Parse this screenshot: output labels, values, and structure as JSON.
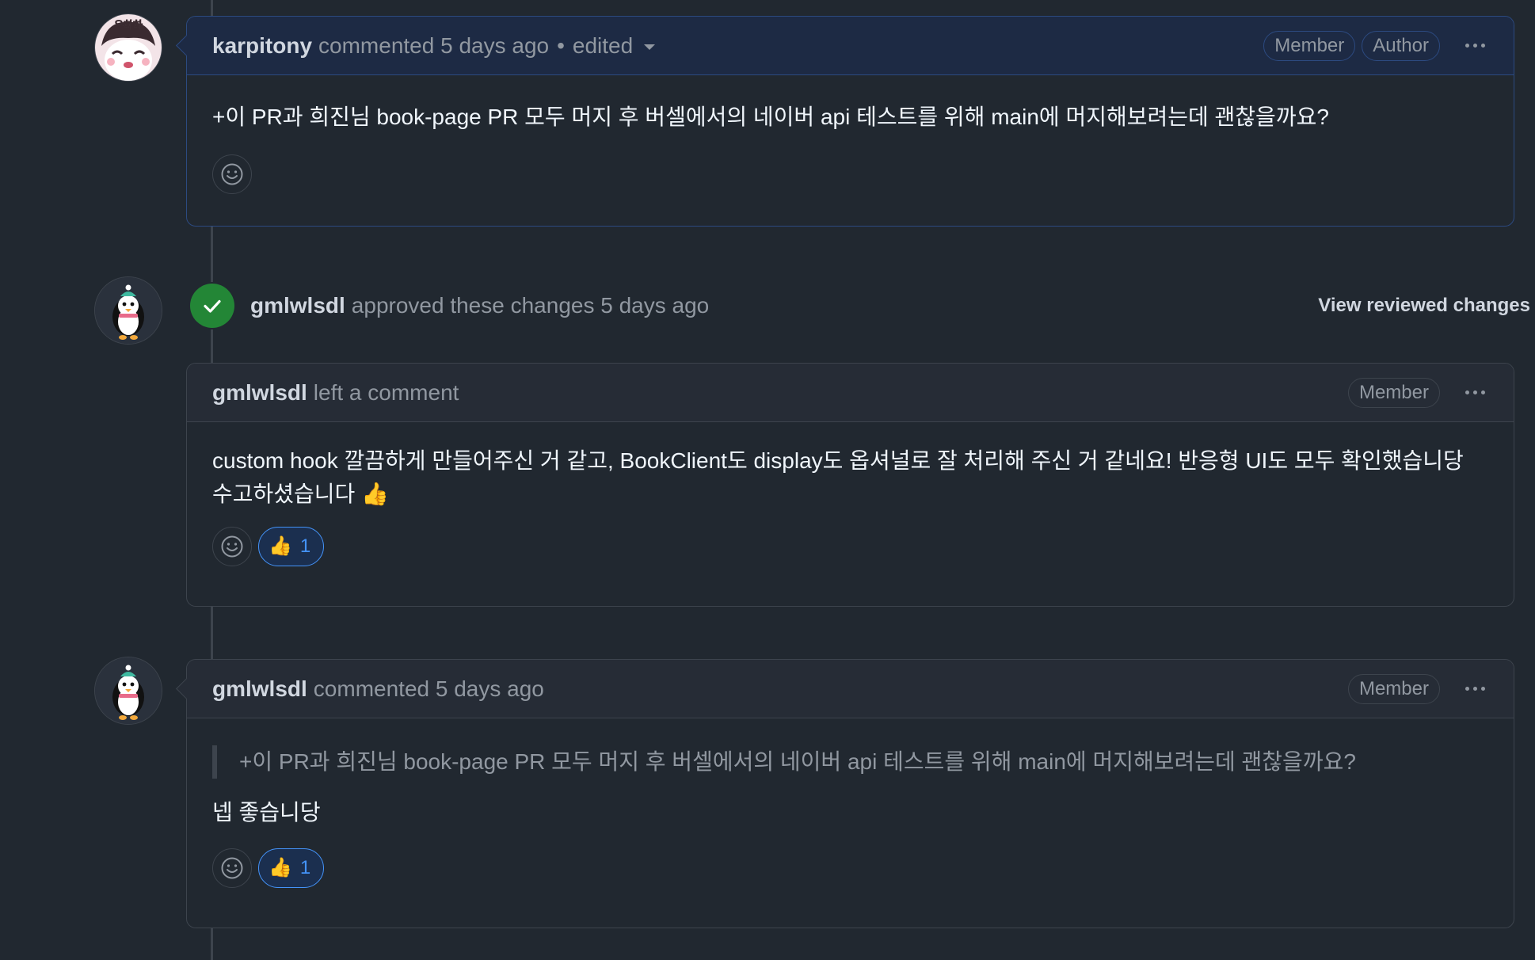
{
  "comment1": {
    "author": "karpitony",
    "action": "commented 5 days ago",
    "separator": "•",
    "edited": "edited",
    "badges": [
      "Member",
      "Author"
    ],
    "body": "+이 PR과 희진님 book-page PR 모두 머지 후 버셀에서의 네이버 api 테스트를 위해 main에 머지해보려는데 괜찮을까요?"
  },
  "review": {
    "author": "gmlwlsdl",
    "action": "approved these changes 5 days ago",
    "link": "View reviewed changes"
  },
  "comment2": {
    "author": "gmlwlsdl",
    "action": "left a comment",
    "badges": [
      "Member"
    ],
    "body": "custom hook 깔끔하게 만들어주신 거 같고, BookClient도 display도 옵셔널로 잘 처리해 주신 거 같네요! 반응형 UI도 모두 확인했습니당 수고하셨습니다 👍",
    "reaction": {
      "emoji": "👍",
      "count": "1"
    }
  },
  "comment3": {
    "author": "gmlwlsdl",
    "action": "commented 5 days ago",
    "badges": [
      "Member"
    ],
    "quote": "+이 PR과 희진님 book-page PR 모두 머지 후 버셀에서의 네이버 api 테스트를 위해 main에 머지해보려는데 괜찮을까요?",
    "body": "넵 좋습니당",
    "reaction": {
      "emoji": "👍",
      "count": "1"
    }
  },
  "icons": {
    "check": "check-icon",
    "smiley": "smiley-icon",
    "kebab": "kebab-horizontal-icon",
    "caret": "triangle-down-icon"
  },
  "colors": {
    "background": "#212830",
    "approved": "#238636",
    "reaction_accent": "#4493f8",
    "author_border": "#2c4a80"
  }
}
